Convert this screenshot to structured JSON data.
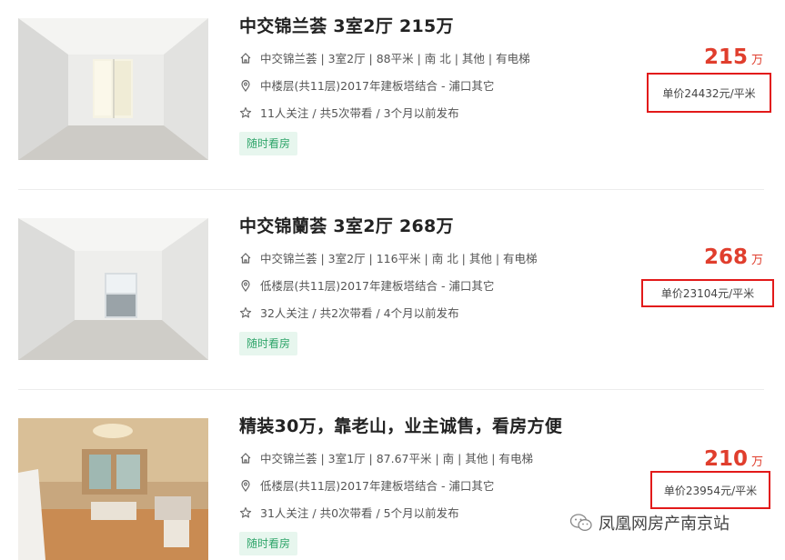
{
  "listings": [
    {
      "title": "中交锦兰荟 3室2厅 215万",
      "house_info": "中交锦兰荟 | 3室2厅 | 88平米 | 南 北 | 其他 | 有电梯",
      "position_info": "中楼层(共11层)2017年建板塔结合 - 浦口其它",
      "follow_info": "11人关注 / 共5次带看 / 3个月以前发布",
      "tag": "随时看房",
      "total_price": "215",
      "price_unit": "万",
      "unit_price": "单价24432元/平米"
    },
    {
      "title": "中交锦蘭荟 3室2厅 268万",
      "house_info": "中交锦兰荟 | 3室2厅 | 116平米 | 南 北 | 其他 | 有电梯",
      "position_info": "低楼层(共11层)2017年建板塔结合 - 浦口其它",
      "follow_info": "32人关注 / 共2次带看 / 4个月以前发布",
      "tag": "随时看房",
      "total_price": "268",
      "price_unit": "万",
      "unit_price": "单价23104元/平米"
    },
    {
      "title": "精装30万，靠老山，业主诚售，看房方便",
      "house_info": "中交锦兰荟 | 3室1厅 | 87.67平米 | 南 | 其他 | 有电梯",
      "position_info": "低楼层(共11层)2017年建板塔结合 - 浦口其它",
      "follow_info": "31人关注 / 共0次带看 / 5个月以前发布",
      "tag": "随时看房",
      "total_price": "210",
      "price_unit": "万",
      "unit_price": "单价23954元/平米"
    }
  ],
  "watermark": {
    "text": "凤凰网房产南京站",
    "icon": "wechat-icon"
  },
  "colors": {
    "price": "#e03e2d",
    "tag_bg": "#e7f6ee",
    "tag_text": "#2fa56a",
    "highlight_box": "#e21a1a"
  }
}
